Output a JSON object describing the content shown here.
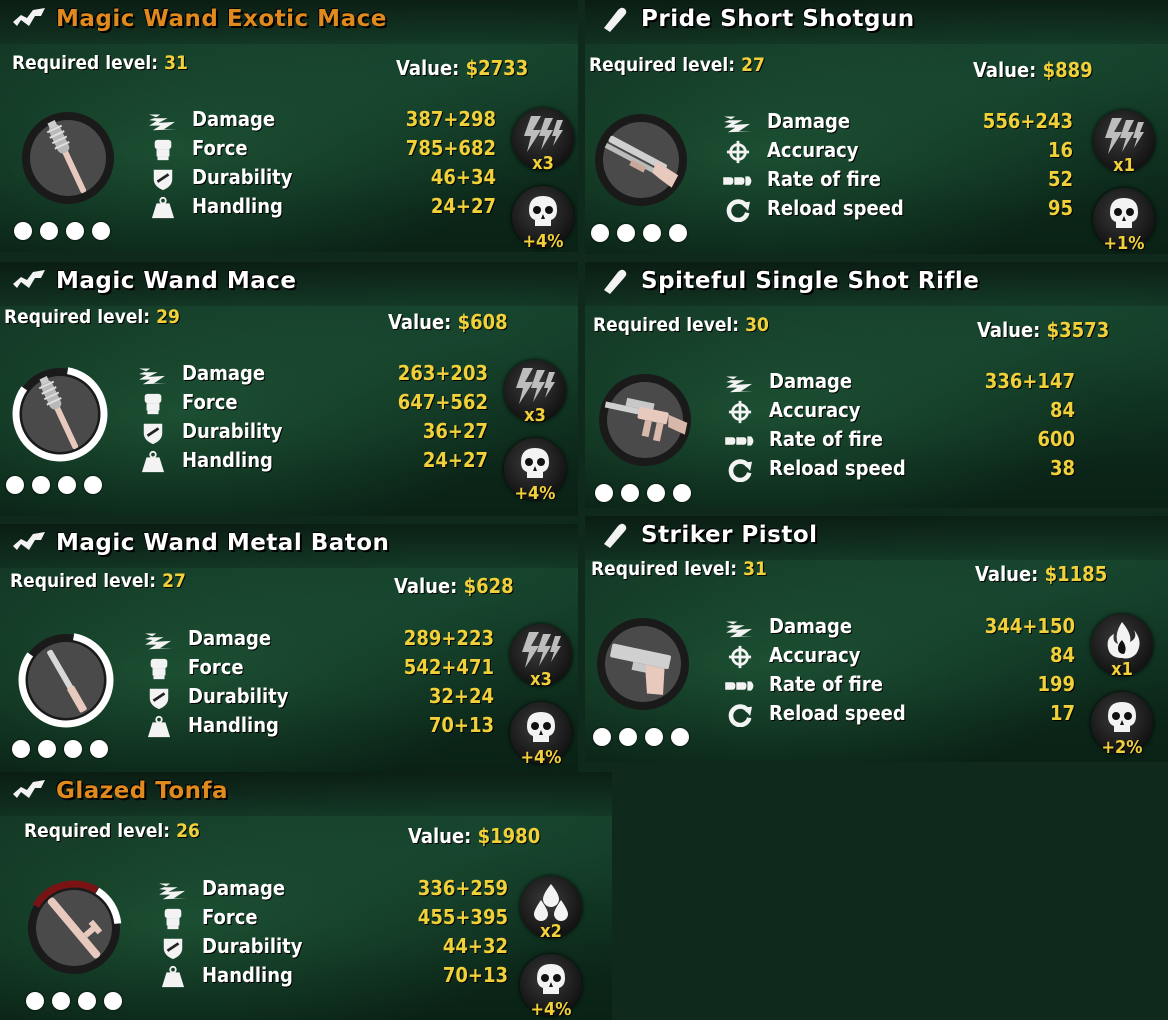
{
  "labels": {
    "required_level": "Required level:",
    "value": "Value:"
  },
  "colors": {
    "accent_yellow": "#f1d13a",
    "rare_orange": "#e08a1e",
    "background": "#0f2a1c"
  },
  "items": [
    {
      "type": "melee",
      "title": "Magic Wand Exotic Mace",
      "title_color": "orange",
      "required_level": "31",
      "value": "$2733",
      "disc_icon": "mace-icon",
      "stats": [
        {
          "icon": "damage-icon",
          "name": "Damage",
          "value": "387+298"
        },
        {
          "icon": "force-icon",
          "name": "Force",
          "value": "785+682"
        },
        {
          "icon": "durability-icon",
          "name": "Durability",
          "value": "46+34"
        },
        {
          "icon": "handling-icon",
          "name": "Handling",
          "value": "24+27"
        }
      ],
      "badges": [
        {
          "icon": "electric-icon",
          "text": "x3"
        },
        {
          "icon": "skull-icon",
          "text": "+4%"
        }
      ]
    },
    {
      "type": "gun",
      "title": "Pride Short Shotgun",
      "title_color": "white",
      "required_level": "27",
      "value": "$889",
      "disc_icon": "shotgun-icon",
      "stats": [
        {
          "icon": "damage-icon",
          "name": "Damage",
          "value": "556+243"
        },
        {
          "icon": "accuracy-icon",
          "name": "Accuracy",
          "value": "16"
        },
        {
          "icon": "rate-of-fire-icon",
          "name": "Rate of fire",
          "value": "52"
        },
        {
          "icon": "reload-icon",
          "name": "Reload speed",
          "value": "95"
        }
      ],
      "badges": [
        {
          "icon": "electric-icon",
          "text": "x1"
        },
        {
          "icon": "skull-icon",
          "text": "+1%"
        }
      ]
    },
    {
      "type": "melee",
      "title": "Magic Wand Mace",
      "title_color": "white",
      "required_level": "29",
      "value": "$608",
      "disc_icon": "mace-icon",
      "stats": [
        {
          "icon": "damage-icon",
          "name": "Damage",
          "value": "263+203"
        },
        {
          "icon": "force-icon",
          "name": "Force",
          "value": "647+562"
        },
        {
          "icon": "durability-icon",
          "name": "Durability",
          "value": "36+27"
        },
        {
          "icon": "handling-icon",
          "name": "Handling",
          "value": "24+27"
        }
      ],
      "badges": [
        {
          "icon": "electric-icon",
          "text": "x3"
        },
        {
          "icon": "skull-icon",
          "text": "+4%"
        }
      ]
    },
    {
      "type": "gun",
      "title": "Spiteful Single Shot Rifle",
      "title_color": "white",
      "required_level": "30",
      "value": "$3573",
      "disc_icon": "rifle-icon",
      "stats": [
        {
          "icon": "damage-icon",
          "name": "Damage",
          "value": "336+147"
        },
        {
          "icon": "accuracy-icon",
          "name": "Accuracy",
          "value": "84"
        },
        {
          "icon": "rate-of-fire-icon",
          "name": "Rate of fire",
          "value": "600"
        },
        {
          "icon": "reload-icon",
          "name": "Reload speed",
          "value": "38"
        }
      ],
      "badges": []
    },
    {
      "type": "melee",
      "title": "Magic Wand Metal Baton",
      "title_color": "white",
      "required_level": "27",
      "value": "$628",
      "disc_icon": "baton-icon",
      "stats": [
        {
          "icon": "damage-icon",
          "name": "Damage",
          "value": "289+223"
        },
        {
          "icon": "force-icon",
          "name": "Force",
          "value": "542+471"
        },
        {
          "icon": "durability-icon",
          "name": "Durability",
          "value": "32+24"
        },
        {
          "icon": "handling-icon",
          "name": "Handling",
          "value": "70+13"
        }
      ],
      "badges": [
        {
          "icon": "electric-icon",
          "text": "x3"
        },
        {
          "icon": "skull-icon",
          "text": "+4%"
        }
      ]
    },
    {
      "type": "gun",
      "title": "Striker Pistol",
      "title_color": "white",
      "required_level": "31",
      "value": "$1185",
      "disc_icon": "pistol-icon",
      "stats": [
        {
          "icon": "damage-icon",
          "name": "Damage",
          "value": "344+150"
        },
        {
          "icon": "accuracy-icon",
          "name": "Accuracy",
          "value": "84"
        },
        {
          "icon": "rate-of-fire-icon",
          "name": "Rate of fire",
          "value": "199"
        },
        {
          "icon": "reload-icon",
          "name": "Reload speed",
          "value": "17"
        }
      ],
      "badges": [
        {
          "icon": "fire-icon",
          "text": "x1"
        },
        {
          "icon": "skull-icon",
          "text": "+2%"
        }
      ]
    },
    {
      "type": "melee",
      "title": "Glazed Tonfa",
      "title_color": "orange",
      "required_level": "26",
      "value": "$1980",
      "disc_icon": "tonfa-icon",
      "stats": [
        {
          "icon": "damage-icon",
          "name": "Damage",
          "value": "336+259"
        },
        {
          "icon": "force-icon",
          "name": "Force",
          "value": "455+395"
        },
        {
          "icon": "durability-icon",
          "name": "Durability",
          "value": "44+32"
        },
        {
          "icon": "handling-icon",
          "name": "Handling",
          "value": "70+13"
        }
      ],
      "badges": [
        {
          "icon": "poison-drops-icon",
          "text": "x2"
        },
        {
          "icon": "skull-icon",
          "text": "+4%"
        }
      ]
    }
  ]
}
